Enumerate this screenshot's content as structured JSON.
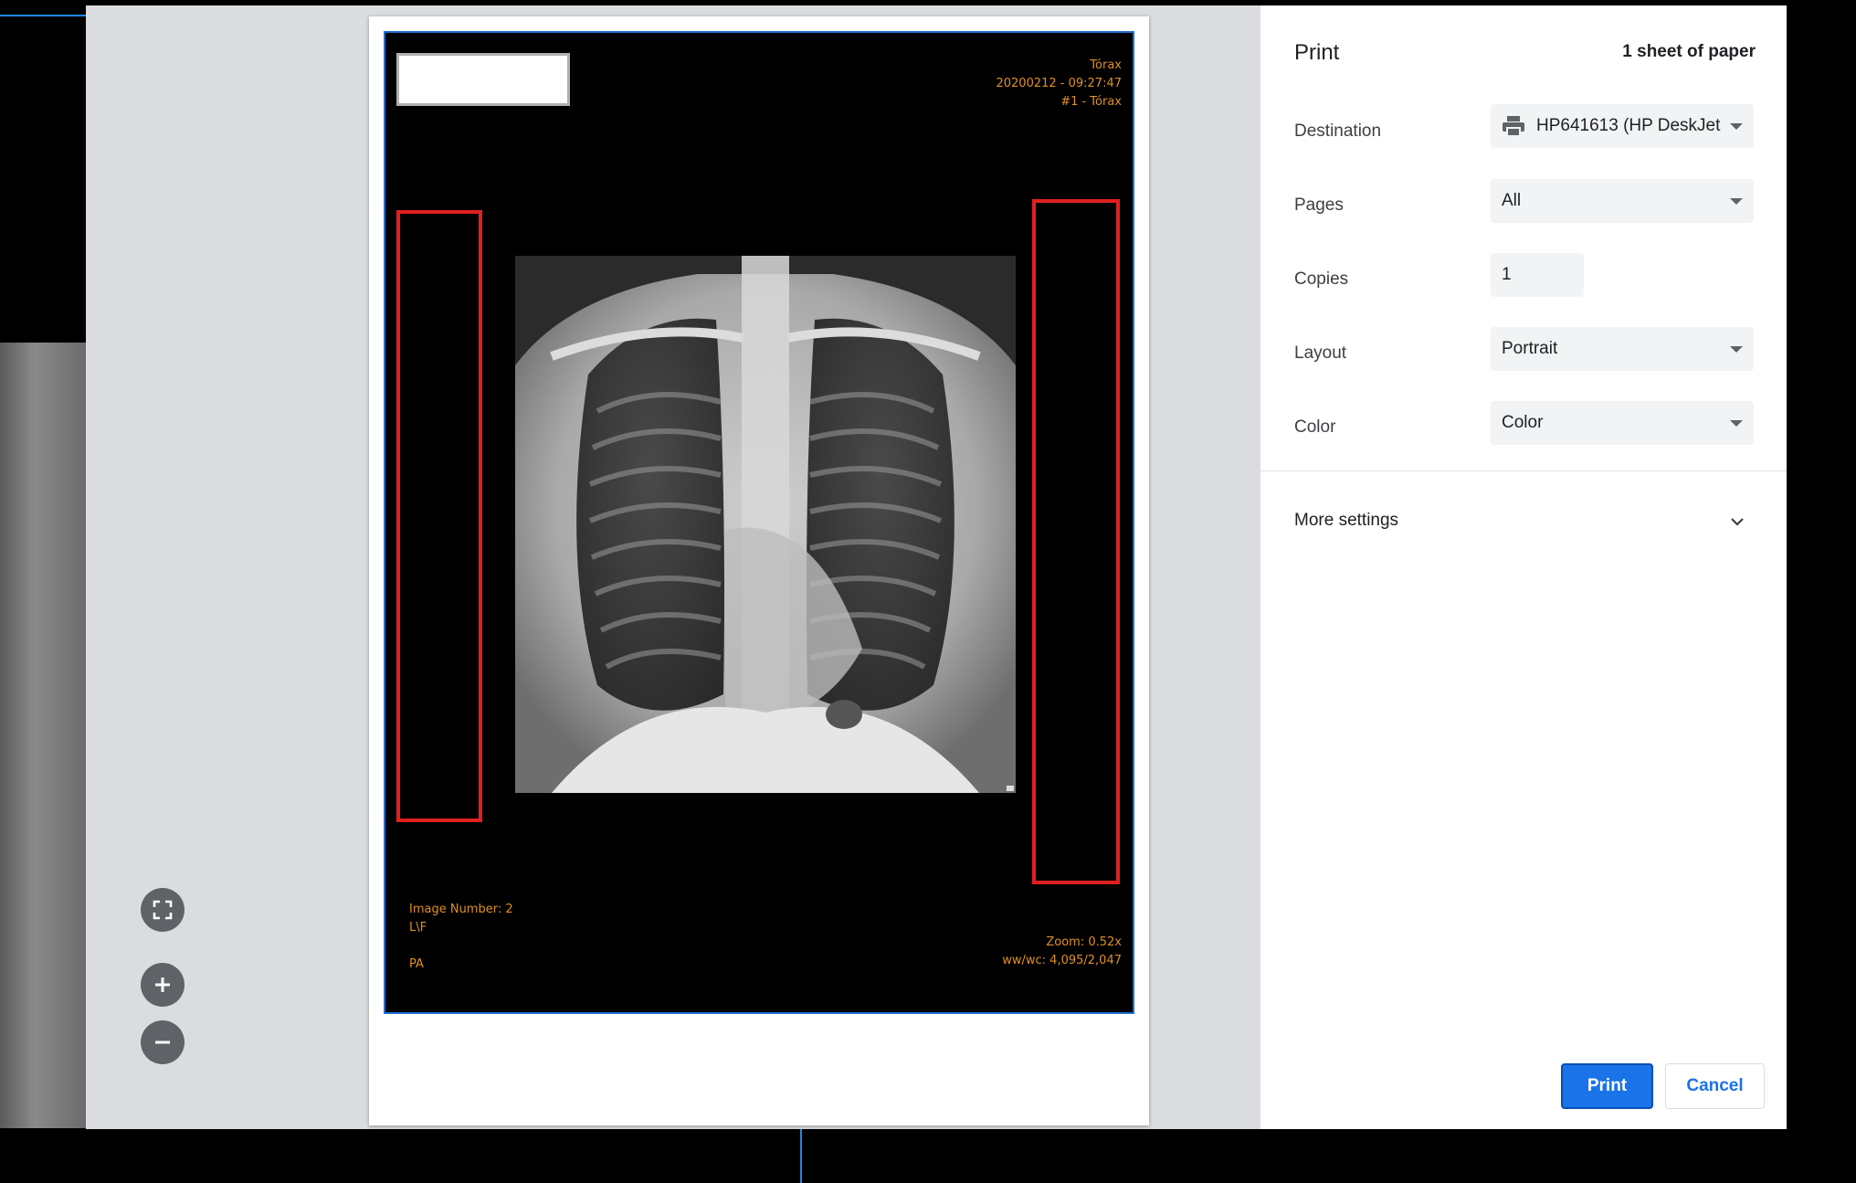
{
  "viewer": {
    "header": {
      "series": "Tórax",
      "datetime": "20200212 - 09:27:47",
      "image_ref": "#1 - Tórax"
    },
    "footer_left": {
      "image_number": "Image Number: 2",
      "orientation_code": "L\\F",
      "view": "PA"
    },
    "footer_right": {
      "zoom": "Zoom: 0.52x",
      "window": "ww/wc: 4,095/2,047"
    }
  },
  "preview_controls": {
    "fit_icon": "fullscreen-icon",
    "zoom_in_icon": "plus-icon",
    "zoom_out_icon": "minus-icon"
  },
  "print_panel": {
    "title": "Print",
    "sheets": "1 sheet of paper",
    "destination": {
      "label": "Destination",
      "value": "HP641613 (HP DeskJet"
    },
    "pages": {
      "label": "Pages",
      "value": "All"
    },
    "copies": {
      "label": "Copies",
      "value": "1"
    },
    "layout": {
      "label": "Layout",
      "value": "Portrait"
    },
    "color": {
      "label": "Color",
      "value": "Color"
    },
    "more_settings": "More settings",
    "print_button": "Print",
    "cancel_button": "Cancel"
  },
  "colors": {
    "accent": "#1a73e8",
    "overlay_text": "#e0901e",
    "redaction_box": "#e02020"
  }
}
